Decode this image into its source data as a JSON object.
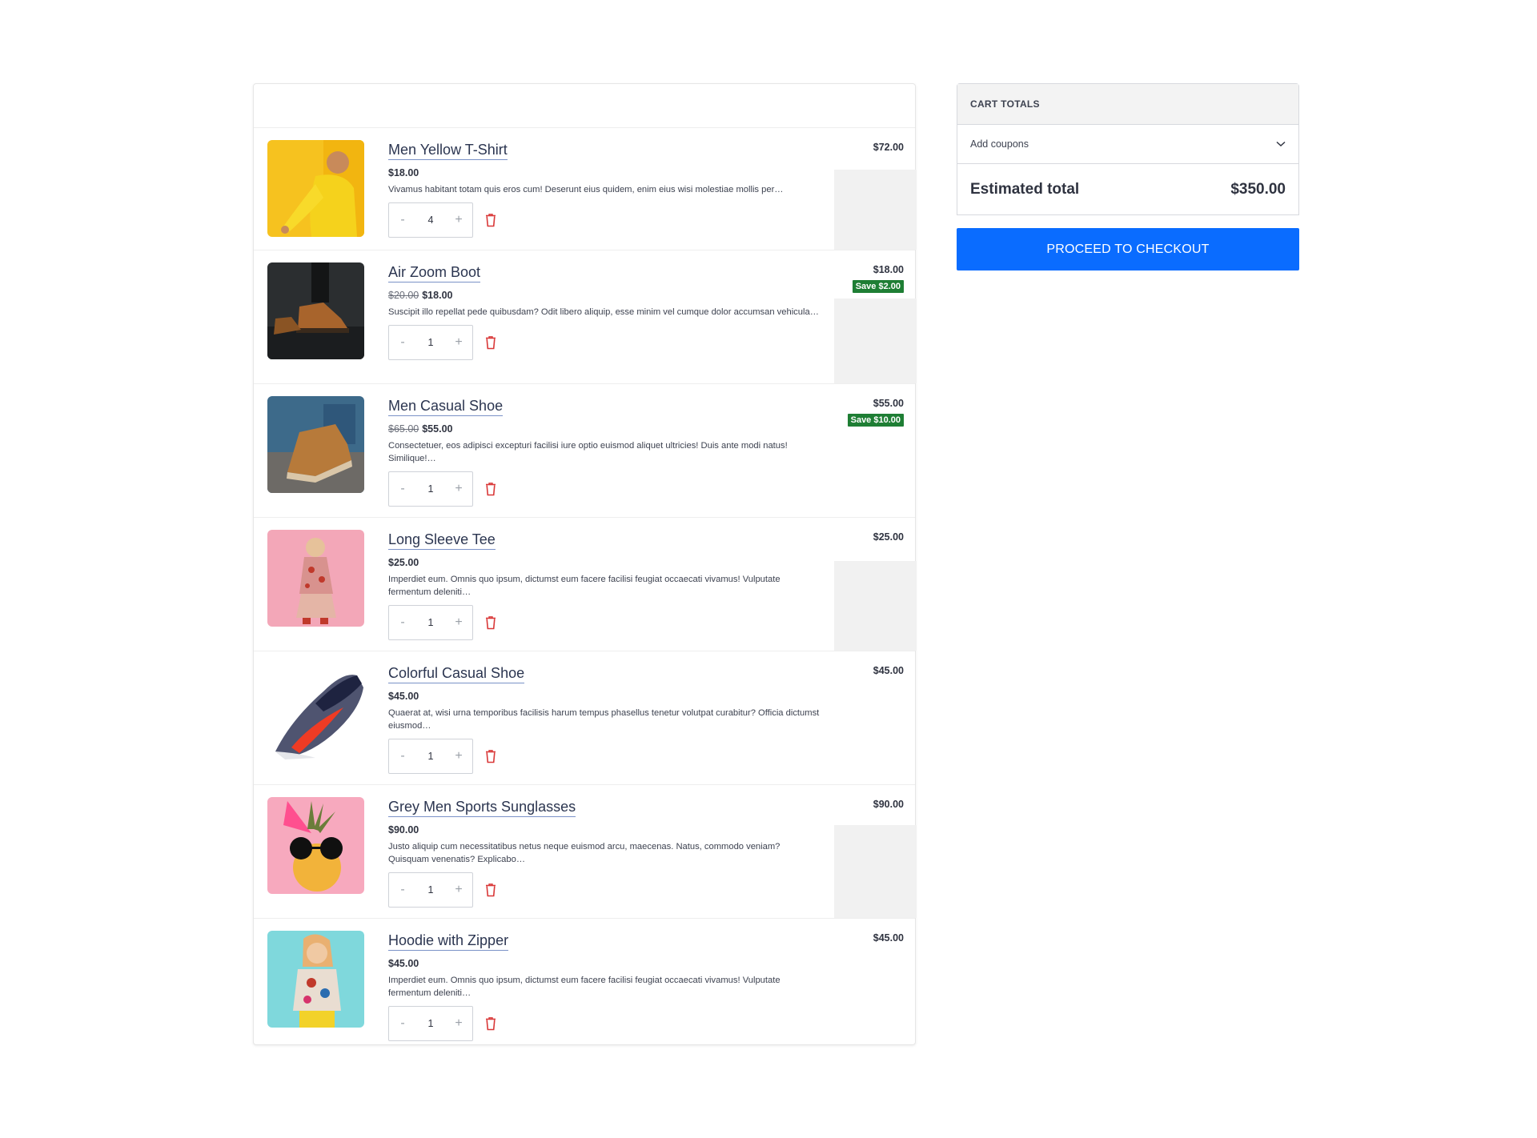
{
  "cart": {
    "items": [
      {
        "name": "Men Yellow T-Shirt",
        "old_price": "",
        "price": "$18.00",
        "description": "Vivamus habitant totam quis eros cum! Deserunt eius quidem, enim eius wisi molestiae mollis per…",
        "quantity": "4",
        "line_total": "$72.00",
        "save": "",
        "image": "yellow-shirt-photo"
      },
      {
        "name": "Air Zoom Boot",
        "old_price": "$20.00",
        "price": "$18.00",
        "description": "Suscipit illo repellat pede quibusdam? Odit libero aliquip, esse minim vel cumque dolor accumsan vehicula…",
        "quantity": "1",
        "line_total": "$18.00",
        "save": "Save $2.00",
        "image": "boot-photo"
      },
      {
        "name": "Men Casual Shoe",
        "old_price": "$65.00",
        "price": "$55.00",
        "description": "Consectetuer, eos adipisci excepturi facilisi iure optio euismod aliquet ultricies! Duis ante modi natus! Similique!…",
        "quantity": "1",
        "line_total": "$55.00",
        "save": "Save $10.00",
        "image": "casual-shoe-photo"
      },
      {
        "name": "Long Sleeve Tee",
        "old_price": "",
        "price": "$25.00",
        "description": "Imperdiet eum. Omnis quo ipsum, dictumst eum facere facilisi feugiat occaecati vivamus! Vulputate fermentum deleniti…",
        "quantity": "1",
        "line_total": "$25.00",
        "save": "",
        "image": "pink-outfit-photo"
      },
      {
        "name": "Colorful Casual Shoe",
        "old_price": "",
        "price": "$45.00",
        "description": "Quaerat at, wisi urna temporibus facilisis harum tempus phasellus tenetur volutpat curabitur? Officia dictumst eiusmod…",
        "quantity": "1",
        "line_total": "$45.00",
        "save": "",
        "image": "sneaker-photo"
      },
      {
        "name": "Grey Men Sports Sunglasses",
        "old_price": "",
        "price": "$90.00",
        "description": "Justo aliquip cum necessitatibus netus neque euismod arcu, maecenas. Natus, commodo veniam? Quisquam venenatis? Explicabo…",
        "quantity": "1",
        "line_total": "$90.00",
        "save": "",
        "image": "pineapple-sunglasses-photo"
      },
      {
        "name": "Hoodie with Zipper",
        "old_price": "",
        "price": "$45.00",
        "description": "Imperdiet eum. Omnis quo ipsum, dictumst eum facere facilisi feugiat occaecati vivamus! Vulputate fermentum deleniti…",
        "quantity": "1",
        "line_total": "$45.00",
        "save": "",
        "image": "woman-hoodie-photo"
      }
    ],
    "qty_minus": "-",
    "qty_plus": "+"
  },
  "totals": {
    "heading": "CART TOTALS",
    "coupons_label": "Add coupons",
    "estimated_label": "Estimated total",
    "estimated_value": "$350.00",
    "checkout_label": "PROCEED TO CHECKOUT"
  },
  "colors": {
    "accent": "#0a6cff",
    "save_badge": "#1e7e34",
    "delete_icon": "#d93838"
  }
}
